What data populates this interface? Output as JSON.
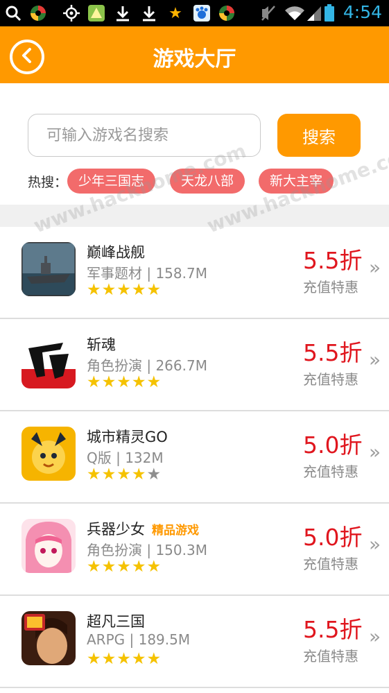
{
  "status_bar": {
    "time": "4:54",
    "icons": [
      "search-icon",
      "app-icon",
      "gps-icon",
      "app-icon",
      "download-icon",
      "download-icon",
      "star-icon",
      "baidu-icon",
      "app-icon",
      "mute-icon",
      "wifi-icon",
      "signal-icon",
      "battery-icon"
    ]
  },
  "header": {
    "title": "游戏大厅",
    "back_icon": "back-arrow-icon",
    "color": "#ff9900"
  },
  "search": {
    "placeholder": "可输入游戏名搜索",
    "button_label": "搜索",
    "hot_label": "热搜：",
    "hot_tags": [
      "少年三国志",
      "天龙八部",
      "新大主宰"
    ]
  },
  "games": [
    {
      "name": "巅峰战舰",
      "badge": "",
      "meta": "军事题材 | 158.7M",
      "rating": 5,
      "discount": "5.5折",
      "promo": "充值特惠"
    },
    {
      "name": "斩魂",
      "badge": "",
      "meta": "角色扮演 | 266.7M",
      "rating": 5,
      "discount": "5.5折",
      "promo": "充值特惠"
    },
    {
      "name": "城市精灵GO",
      "badge": "",
      "meta": "Q版 | 132M",
      "rating": 4,
      "discount": "5.0折",
      "promo": "充值特惠"
    },
    {
      "name": "兵器少女",
      "badge": "精品游戏",
      "meta": "角色扮演 | 150.3M",
      "rating": 5,
      "discount": "5.0折",
      "promo": "充值特惠"
    },
    {
      "name": "超凡三国",
      "badge": "",
      "meta": "ARPG | 189.5M",
      "rating": 5,
      "discount": "5.5折",
      "promo": "充值特惠"
    }
  ],
  "arrow_glyph": "»",
  "star_glyph": "★",
  "watermark": "www.hackhome.com"
}
